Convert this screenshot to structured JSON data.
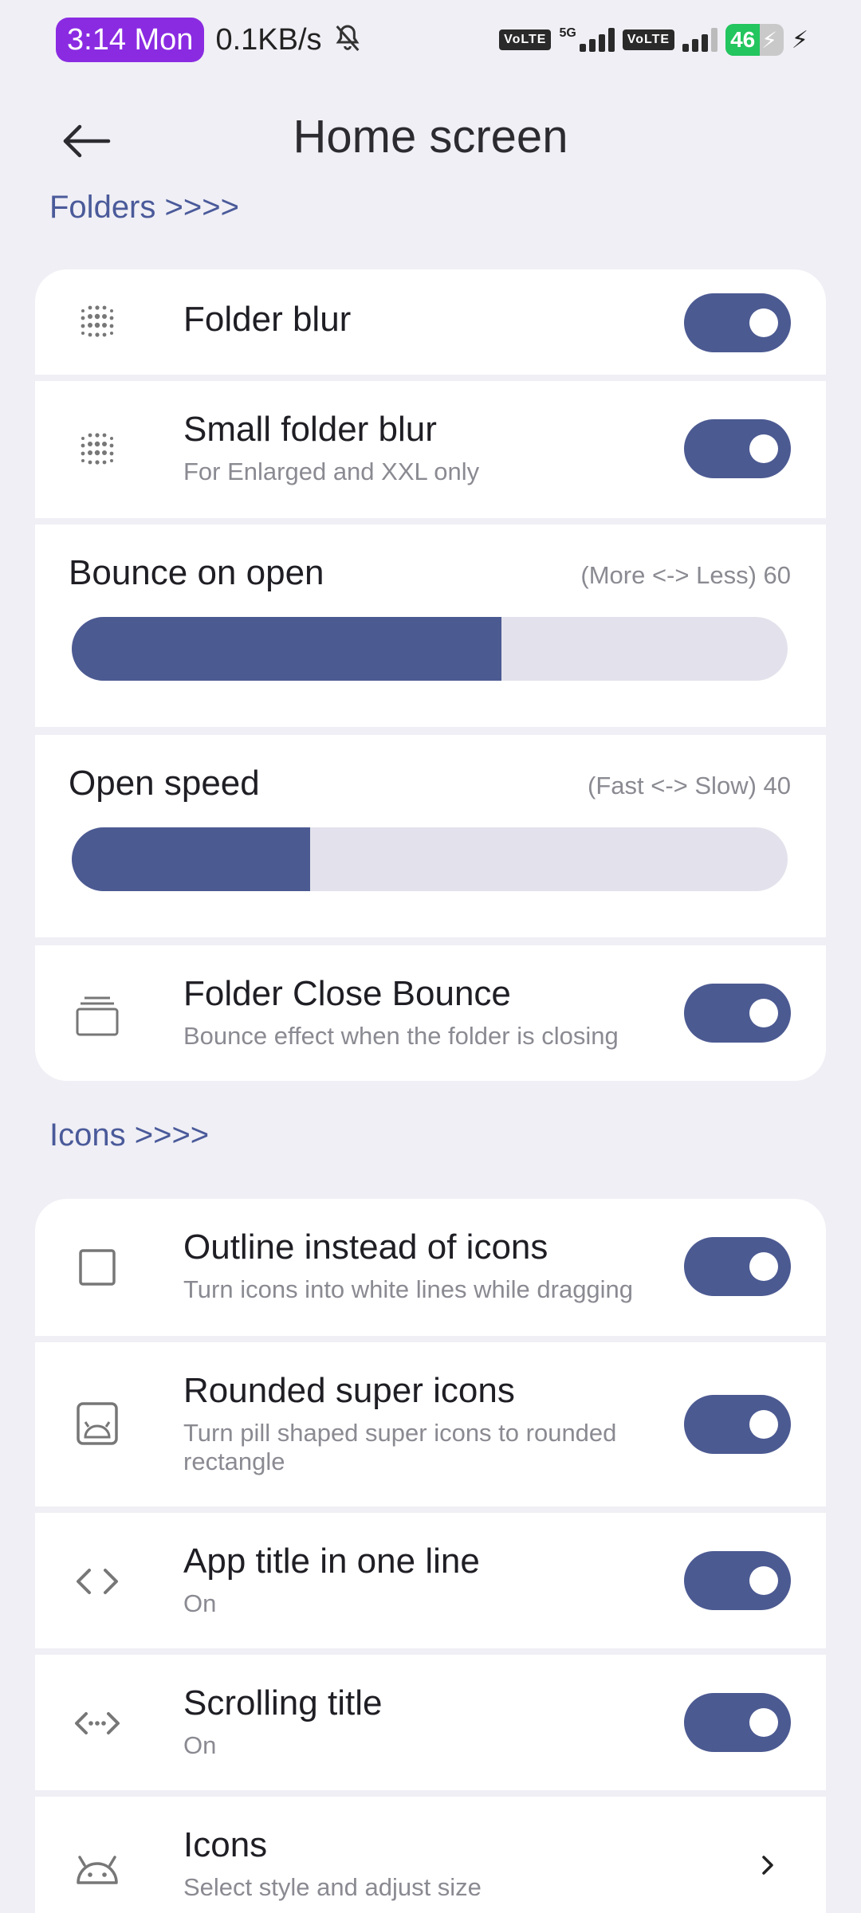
{
  "status_bar": {
    "time": "3:14 Mon",
    "net_speed": "0.1KB/s",
    "volte1": "VoLTE",
    "network_type": "5G",
    "volte2": "VoLTE",
    "battery": "46"
  },
  "header": {
    "title": "Home screen"
  },
  "sections": {
    "folders": "Folders >>>>",
    "icons": "Icons >>>>"
  },
  "folder_blur": {
    "title": "Folder blur",
    "enabled": true
  },
  "small_folder_blur": {
    "title": "Small folder blur",
    "subtitle": "For Enlarged and XXL only",
    "enabled": true
  },
  "bounce_on_open": {
    "title": "Bounce on open",
    "value_label": "(More <-> Less) 60",
    "value": 60,
    "fraction": 0.6
  },
  "open_speed": {
    "title": "Open speed",
    "value_label": "(Fast <-> Slow) 40",
    "value": 40,
    "fraction": 0.333
  },
  "folder_close_bounce": {
    "title": "Folder Close Bounce",
    "subtitle": "Bounce effect when the folder is closing",
    "enabled": true
  },
  "outline_icons": {
    "title": "Outline instead of icons",
    "subtitle": "Turn icons into white lines while dragging",
    "enabled": true
  },
  "rounded_super_icons": {
    "title": "Rounded super icons",
    "subtitle": "Turn pill shaped super icons to rounded rectangle",
    "enabled": true
  },
  "app_title_one_line": {
    "title": "App title in one line",
    "subtitle": "On",
    "enabled": true
  },
  "scrolling_title": {
    "title": "Scrolling title",
    "subtitle": "On",
    "enabled": true
  },
  "icons_item": {
    "title": "Icons",
    "subtitle": "Select style and adjust size"
  },
  "colors": {
    "accent": "#4c5a92",
    "track": "#e3e2ec",
    "background": "#f0eff5",
    "section_title": "#4a5a9a",
    "time_pill": "#8a2be2",
    "battery": "#22c55e"
  }
}
